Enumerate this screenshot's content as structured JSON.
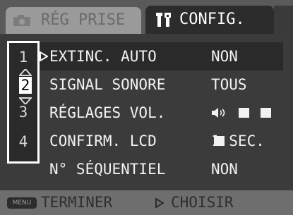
{
  "tabs": {
    "inactive_label": "RÉG PRISE",
    "active_label": "CONFIG."
  },
  "pages": {
    "items": [
      "1",
      "2",
      "3",
      "4"
    ],
    "selected": "2"
  },
  "rows": [
    {
      "name": "EXTINC. AUTO",
      "value": "NON"
    },
    {
      "name": "SIGNAL SONORE",
      "value": "TOUS"
    },
    {
      "name": "RÉGLAGES VOL.",
      "value": "",
      "volume_level": 3
    },
    {
      "name": "CONFIRM. LCD",
      "value": "1 SEC."
    },
    {
      "name": "N° SÉQUENTIEL",
      "value": "NON"
    }
  ],
  "footer": {
    "menu_key_label": "MENU",
    "end_label": "TERMINER",
    "choose_label": "CHOISIR"
  },
  "colors": {
    "text": "#f2f2f2",
    "panel": "#3b3b3b",
    "footer": "#6e6e6e"
  },
  "icons": {
    "shooting_tab": "camera-icon",
    "setup_tab": "tools-icon",
    "volume": "speaker-icon",
    "cursor": "play-arrow-icon"
  }
}
